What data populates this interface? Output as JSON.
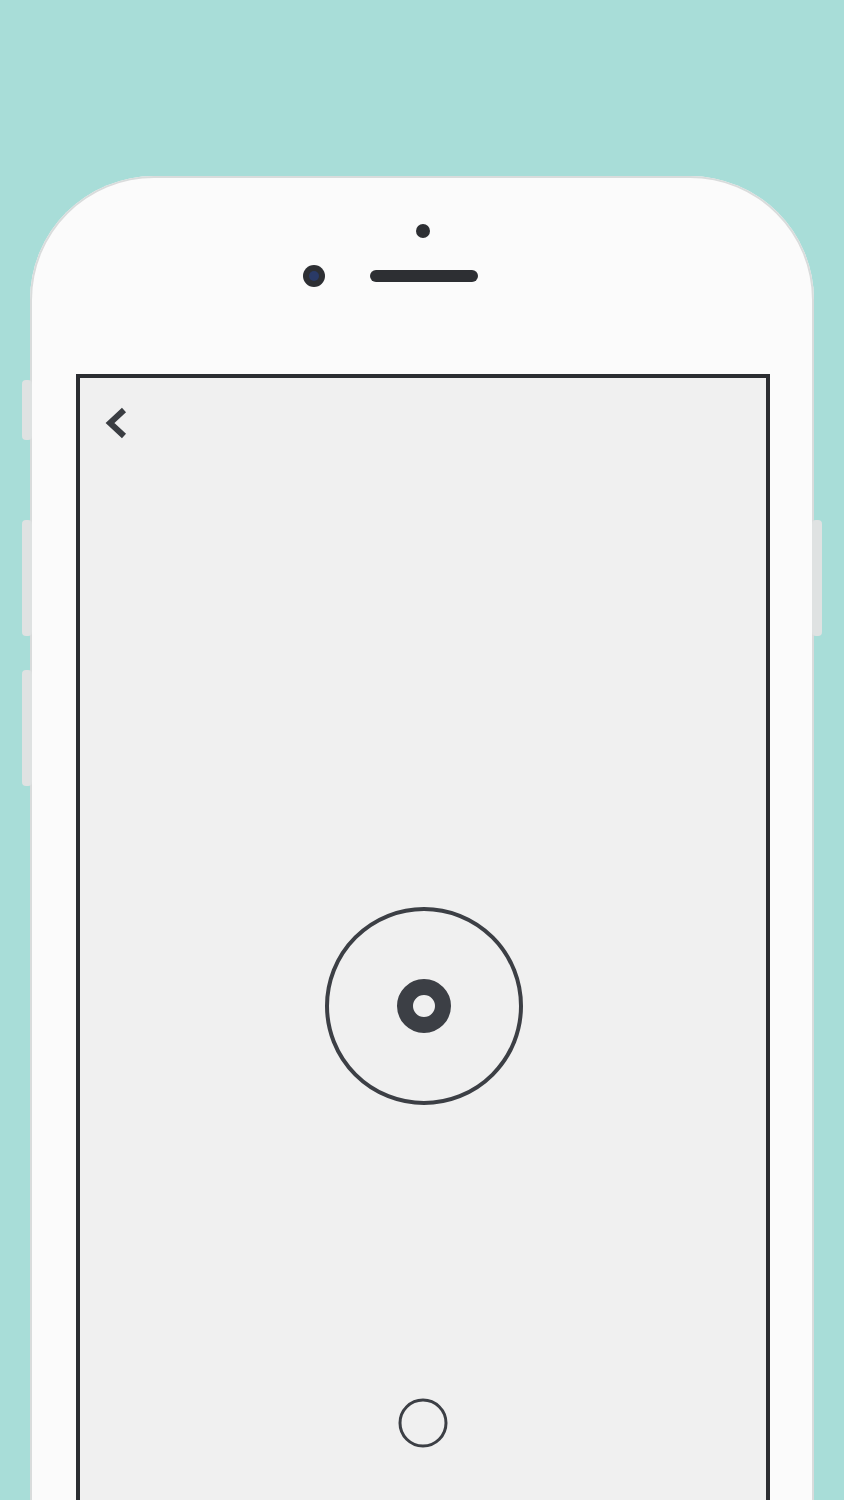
{
  "device": {
    "kind": "phone"
  },
  "screen": {
    "controls": [
      {
        "kind": "back"
      },
      {
        "kind": "record"
      },
      {
        "kind": "shutter"
      }
    ]
  }
}
